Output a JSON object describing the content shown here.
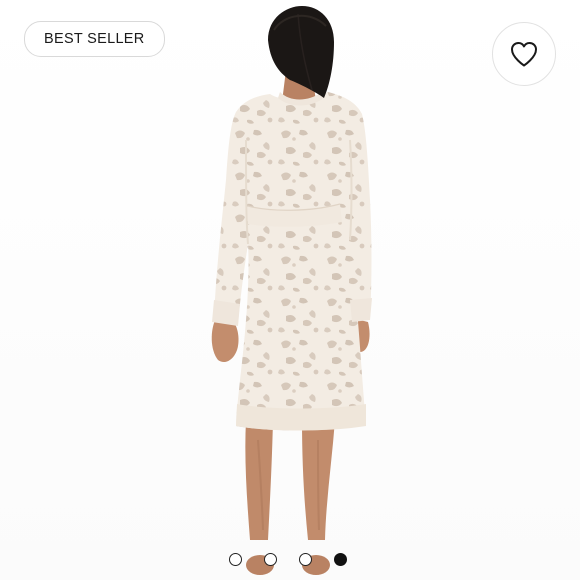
{
  "badge": {
    "label": "BEST SELLER"
  },
  "like_button": {
    "icon": "heart-outline-icon"
  },
  "carousel": {
    "total_images": 4,
    "active_index": 3
  },
  "colors": {
    "garment_base": "#f3ece3",
    "garment_pattern": "#d4c7b9",
    "skin": "#c48d6d",
    "hair": "#1b1715",
    "dot_active": "#111111"
  }
}
